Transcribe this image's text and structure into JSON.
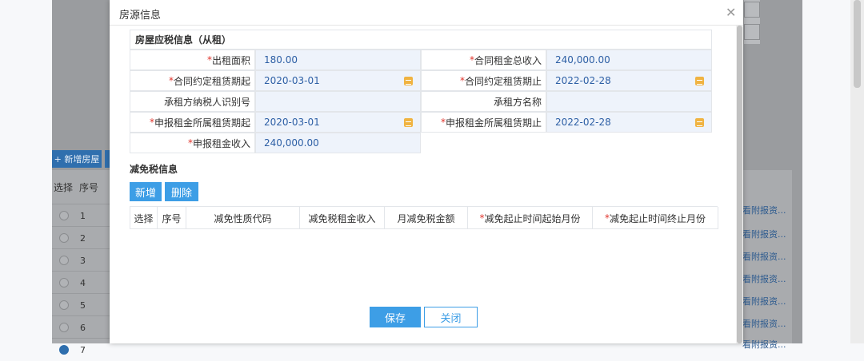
{
  "background": {
    "add_house_label": "+ 新增房屋",
    "col_select": "选择",
    "col_no": "序号",
    "rows": [
      "1",
      "2",
      "3",
      "4",
      "5",
      "6",
      "7"
    ],
    "attachment_link": "看附报资..."
  },
  "modal": {
    "title": "房源信息",
    "section1_title": "房屋应税信息（从租）",
    "fields": {
      "rent_area_label": "出租面积",
      "rent_area_value": "180.00",
      "total_rent_label": "合同租金总收入",
      "total_rent_value": "240,000.00",
      "contract_start_label": "合同约定租赁期起",
      "contract_start_value": "2020-03-01",
      "contract_end_label": "合同约定租赁期止",
      "contract_end_value": "2022-02-28",
      "tenant_taxid_label": "承租方纳税人识别号",
      "tenant_taxid_value": "",
      "tenant_name_label": "承租方名称",
      "tenant_name_value": "",
      "declare_start_label": "申报租金所属租赁期起",
      "declare_start_value": "2020-03-01",
      "declare_end_label": "申报租金所属租赁期止",
      "declare_end_value": "2022-02-28",
      "declare_income_label": "申报租金收入",
      "declare_income_value": "240,000.00"
    },
    "section2_title": "减免税信息",
    "add_label": "新增",
    "delete_label": "删除",
    "exemption_columns": [
      "选择",
      "序号",
      "减免性质代码",
      "减免税租金收入",
      "月减免税金额",
      "减免起止时间起始月份",
      "减免起止时间终止月份"
    ],
    "save_label": "保存",
    "close_label": "关闭"
  },
  "colors": {
    "accent": "#3d9ee6",
    "required": "#e0342c",
    "value_bg": "#eef3fb"
  }
}
